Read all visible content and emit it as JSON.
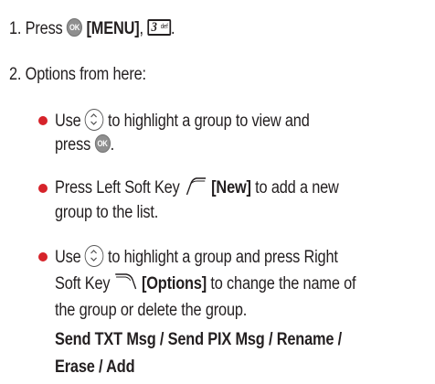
{
  "colors": {
    "bullet": "#d6232a",
    "text": "#231f20",
    "ok_key": "#8f8f8f"
  },
  "icons": {
    "ok_key": "OK",
    "key_3_num": "3",
    "key_3_letters": "def"
  },
  "step1": {
    "prefix": "1. Press",
    "menu_label": "[MENU]",
    "comma": ",",
    "period": "."
  },
  "step2": {
    "text": "2. Options from here:"
  },
  "bullet1": {
    "use": "Use",
    "line1_rest": "to highlight a group to view and",
    "press": "press",
    "period": "."
  },
  "bullet2": {
    "line1_prefix": "Press Left Soft Key",
    "new_label": "[New]",
    "line1_rest": "to add a new",
    "line2": "group to the list."
  },
  "bullet3": {
    "use": "Use",
    "line1_rest": "to highlight a group and press Right",
    "line2_prefix": "Soft Key",
    "options_label": "[Options]",
    "line2_rest": "to change the name of",
    "line3": "the group or delete the group."
  },
  "options": {
    "send_txt": "Send TXT Msg",
    "send_pix": "Send PIX Msg",
    "rename": "Rename",
    "erase": "Erase",
    "add": "Add",
    "sep": " / "
  }
}
